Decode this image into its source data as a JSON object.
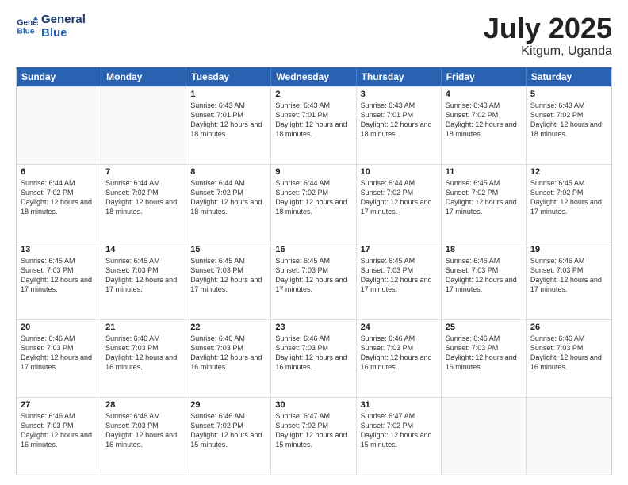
{
  "header": {
    "logo_line1": "General",
    "logo_line2": "Blue",
    "month_year": "July 2025",
    "location": "Kitgum, Uganda"
  },
  "days_of_week": [
    "Sunday",
    "Monday",
    "Tuesday",
    "Wednesday",
    "Thursday",
    "Friday",
    "Saturday"
  ],
  "weeks": [
    [
      {
        "day": "",
        "info": ""
      },
      {
        "day": "",
        "info": ""
      },
      {
        "day": "1",
        "info": "Sunrise: 6:43 AM\nSunset: 7:01 PM\nDaylight: 12 hours and 18 minutes."
      },
      {
        "day": "2",
        "info": "Sunrise: 6:43 AM\nSunset: 7:01 PM\nDaylight: 12 hours and 18 minutes."
      },
      {
        "day": "3",
        "info": "Sunrise: 6:43 AM\nSunset: 7:01 PM\nDaylight: 12 hours and 18 minutes."
      },
      {
        "day": "4",
        "info": "Sunrise: 6:43 AM\nSunset: 7:02 PM\nDaylight: 12 hours and 18 minutes."
      },
      {
        "day": "5",
        "info": "Sunrise: 6:43 AM\nSunset: 7:02 PM\nDaylight: 12 hours and 18 minutes."
      }
    ],
    [
      {
        "day": "6",
        "info": "Sunrise: 6:44 AM\nSunset: 7:02 PM\nDaylight: 12 hours and 18 minutes."
      },
      {
        "day": "7",
        "info": "Sunrise: 6:44 AM\nSunset: 7:02 PM\nDaylight: 12 hours and 18 minutes."
      },
      {
        "day": "8",
        "info": "Sunrise: 6:44 AM\nSunset: 7:02 PM\nDaylight: 12 hours and 18 minutes."
      },
      {
        "day": "9",
        "info": "Sunrise: 6:44 AM\nSunset: 7:02 PM\nDaylight: 12 hours and 18 minutes."
      },
      {
        "day": "10",
        "info": "Sunrise: 6:44 AM\nSunset: 7:02 PM\nDaylight: 12 hours and 17 minutes."
      },
      {
        "day": "11",
        "info": "Sunrise: 6:45 AM\nSunset: 7:02 PM\nDaylight: 12 hours and 17 minutes."
      },
      {
        "day": "12",
        "info": "Sunrise: 6:45 AM\nSunset: 7:02 PM\nDaylight: 12 hours and 17 minutes."
      }
    ],
    [
      {
        "day": "13",
        "info": "Sunrise: 6:45 AM\nSunset: 7:03 PM\nDaylight: 12 hours and 17 minutes."
      },
      {
        "day": "14",
        "info": "Sunrise: 6:45 AM\nSunset: 7:03 PM\nDaylight: 12 hours and 17 minutes."
      },
      {
        "day": "15",
        "info": "Sunrise: 6:45 AM\nSunset: 7:03 PM\nDaylight: 12 hours and 17 minutes."
      },
      {
        "day": "16",
        "info": "Sunrise: 6:45 AM\nSunset: 7:03 PM\nDaylight: 12 hours and 17 minutes."
      },
      {
        "day": "17",
        "info": "Sunrise: 6:45 AM\nSunset: 7:03 PM\nDaylight: 12 hours and 17 minutes."
      },
      {
        "day": "18",
        "info": "Sunrise: 6:46 AM\nSunset: 7:03 PM\nDaylight: 12 hours and 17 minutes."
      },
      {
        "day": "19",
        "info": "Sunrise: 6:46 AM\nSunset: 7:03 PM\nDaylight: 12 hours and 17 minutes."
      }
    ],
    [
      {
        "day": "20",
        "info": "Sunrise: 6:46 AM\nSunset: 7:03 PM\nDaylight: 12 hours and 17 minutes."
      },
      {
        "day": "21",
        "info": "Sunrise: 6:46 AM\nSunset: 7:03 PM\nDaylight: 12 hours and 16 minutes."
      },
      {
        "day": "22",
        "info": "Sunrise: 6:46 AM\nSunset: 7:03 PM\nDaylight: 12 hours and 16 minutes."
      },
      {
        "day": "23",
        "info": "Sunrise: 6:46 AM\nSunset: 7:03 PM\nDaylight: 12 hours and 16 minutes."
      },
      {
        "day": "24",
        "info": "Sunrise: 6:46 AM\nSunset: 7:03 PM\nDaylight: 12 hours and 16 minutes."
      },
      {
        "day": "25",
        "info": "Sunrise: 6:46 AM\nSunset: 7:03 PM\nDaylight: 12 hours and 16 minutes."
      },
      {
        "day": "26",
        "info": "Sunrise: 6:46 AM\nSunset: 7:03 PM\nDaylight: 12 hours and 16 minutes."
      }
    ],
    [
      {
        "day": "27",
        "info": "Sunrise: 6:46 AM\nSunset: 7:03 PM\nDaylight: 12 hours and 16 minutes."
      },
      {
        "day": "28",
        "info": "Sunrise: 6:46 AM\nSunset: 7:03 PM\nDaylight: 12 hours and 16 minutes."
      },
      {
        "day": "29",
        "info": "Sunrise: 6:46 AM\nSunset: 7:02 PM\nDaylight: 12 hours and 15 minutes."
      },
      {
        "day": "30",
        "info": "Sunrise: 6:47 AM\nSunset: 7:02 PM\nDaylight: 12 hours and 15 minutes."
      },
      {
        "day": "31",
        "info": "Sunrise: 6:47 AM\nSunset: 7:02 PM\nDaylight: 12 hours and 15 minutes."
      },
      {
        "day": "",
        "info": ""
      },
      {
        "day": "",
        "info": ""
      }
    ]
  ]
}
